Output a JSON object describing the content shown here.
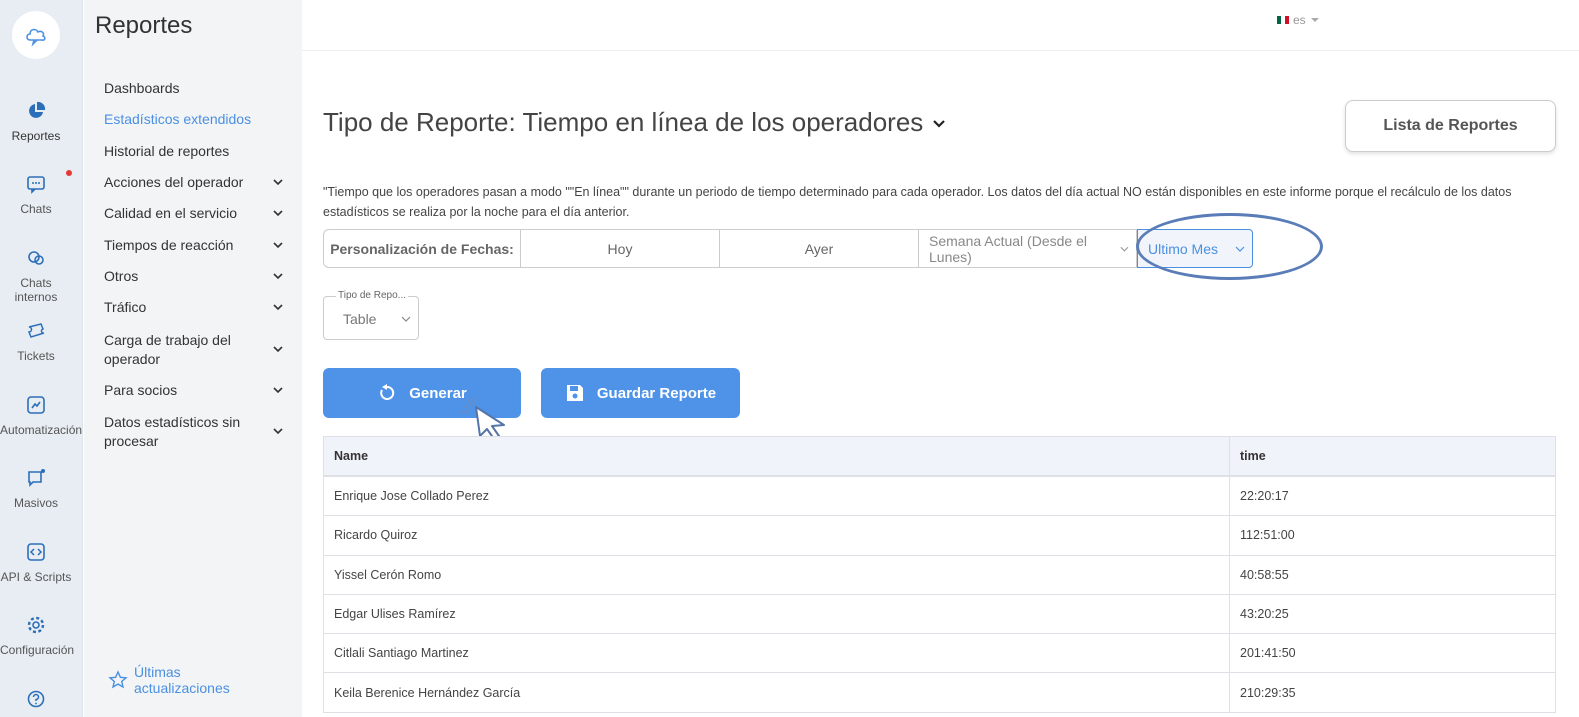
{
  "rail": {
    "items": [
      {
        "label": "Reportes",
        "icon": "pie-chart-icon"
      },
      {
        "label": "Chats",
        "icon": "chat-icon"
      },
      {
        "label": "Chats internos",
        "icon": "internal-chats-icon"
      },
      {
        "label": "Tickets",
        "icon": "ticket-icon"
      },
      {
        "label": "Automatización",
        "icon": "automation-icon"
      },
      {
        "label": "Masivos",
        "icon": "broadcast-icon"
      },
      {
        "label": "API & Scripts",
        "icon": "code-icon"
      },
      {
        "label": "Configuración",
        "icon": "gear-icon"
      }
    ]
  },
  "sidebar": {
    "title": "Reportes",
    "items": [
      {
        "label": "Dashboards"
      },
      {
        "label": "Estadísticos extendidos"
      },
      {
        "label": "Historial de reportes"
      },
      {
        "label": "Acciones del operador"
      },
      {
        "label": "Calidad en el servicio"
      },
      {
        "label": "Tiempos de reacción"
      },
      {
        "label": "Otros"
      },
      {
        "label": "Tráfico"
      },
      {
        "label": "Carga de trabajo del operador"
      },
      {
        "label": "Para socios"
      },
      {
        "label": "Datos estadísticos sin procesar"
      }
    ],
    "updates_label": "Últimas actualizaciones"
  },
  "topbar": {
    "lang": "es"
  },
  "main": {
    "title": "Tipo de Reporte: Tiempo en línea de los operadores",
    "list_button": "Lista de Reportes",
    "description": "\"Tiempo que los operadores pasan a modo \"\"En línea\"\" durante un periodo de tiempo determinado para cada operador. Los datos del día actual NO están disponibles en este informe porque el recálculo de los datos estadísticos se realiza por la noche para el día anterior.",
    "dates": {
      "label": "Personalización de Fechas:",
      "today": "Hoy",
      "yesterday": "Ayer",
      "week": "Semana Actual (Desde el Lunes)",
      "month": "Ultimo Mes"
    },
    "report_type": {
      "legend": "Tipo de Repo...",
      "value": "Table"
    },
    "generate_button": "Generar",
    "save_button": "Guardar Reporte",
    "table": {
      "headers": [
        "Name",
        "time"
      ],
      "rows": [
        [
          "Enrique Jose Collado Perez",
          "22:20:17"
        ],
        [
          "Ricardo Quiroz",
          "112:51:00"
        ],
        [
          "Yissel Cerón Romo",
          "40:58:55"
        ],
        [
          "Edgar Ulises Ramírez",
          "43:20:25"
        ],
        [
          "Citlali Santiago Martinez",
          "201:41:50"
        ],
        [
          "Keila Berenice Hernández García",
          "210:29:35"
        ]
      ]
    }
  },
  "colors": {
    "accent": "#4f93e8",
    "link": "#4a90e2",
    "highlight_ellipse": "#5a7db8"
  }
}
